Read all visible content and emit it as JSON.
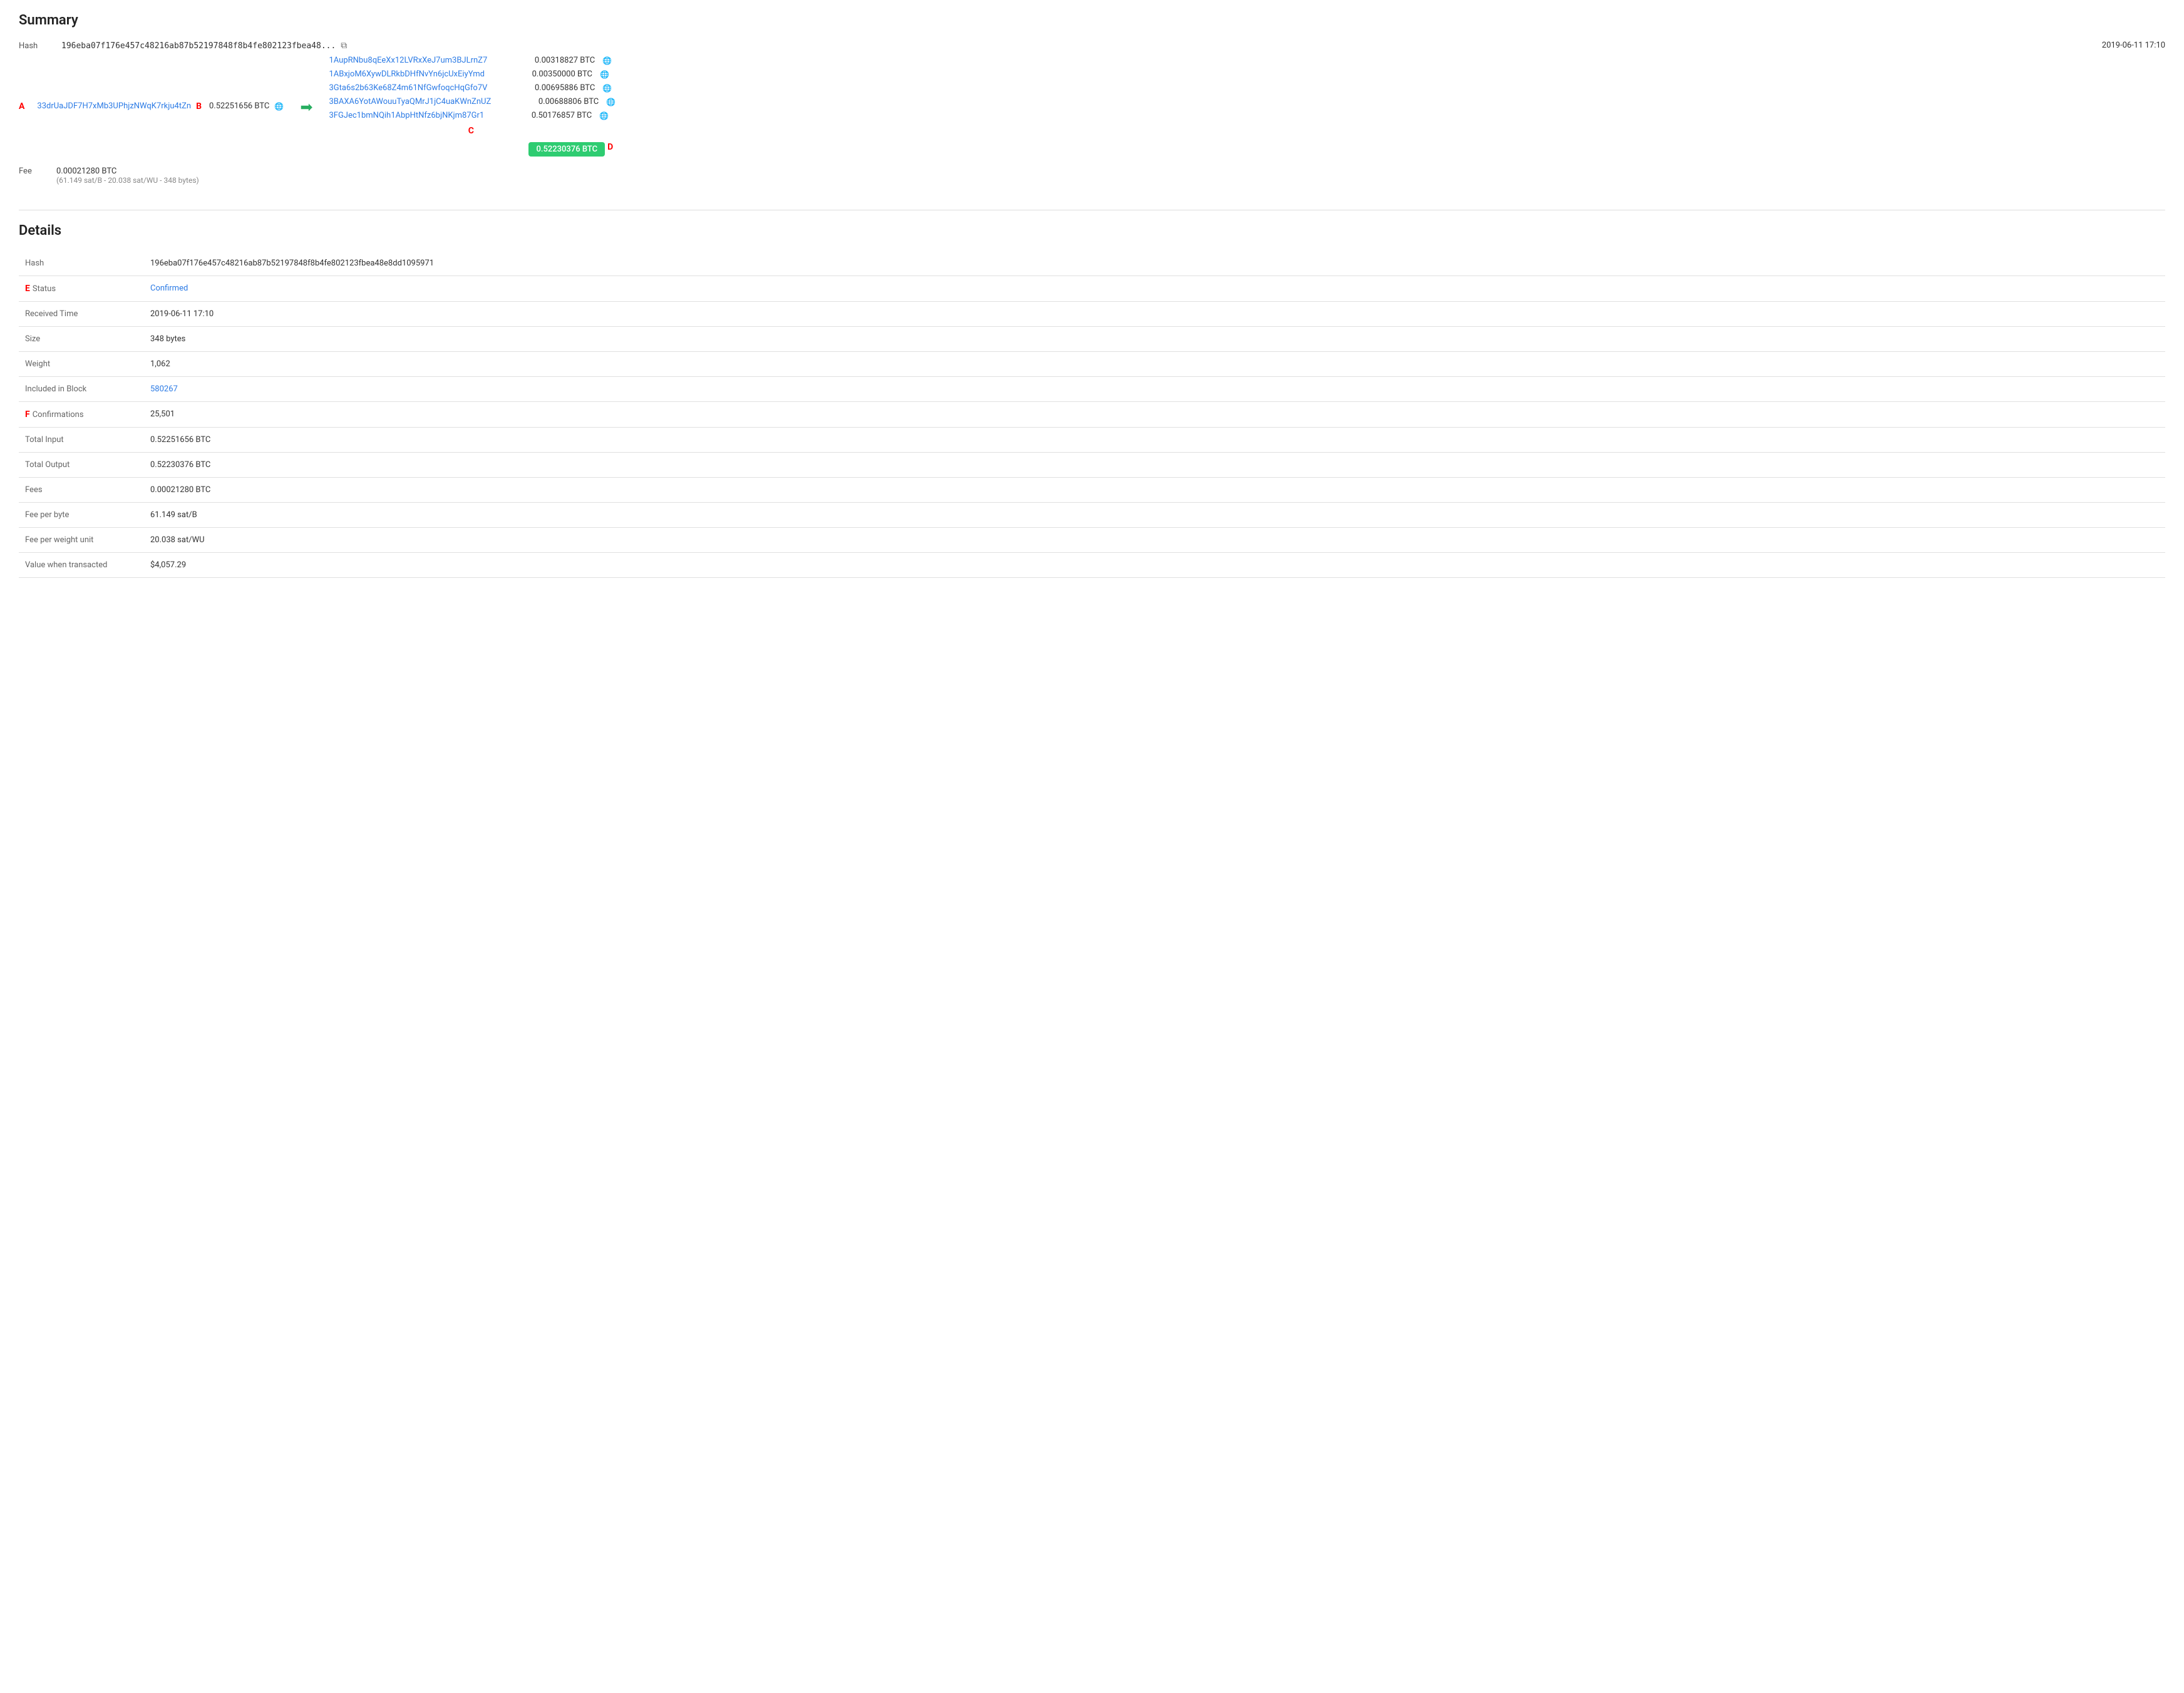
{
  "page": {
    "summary_title": "Summary",
    "details_title": "Details",
    "label_a": "A",
    "label_b": "B",
    "label_c": "C",
    "label_d": "D",
    "label_e": "E",
    "label_f": "F"
  },
  "summary": {
    "hash_label": "Hash",
    "hash_short": "196eba07f176e457c48216ab87b52197848f8b4fe802123fbea48...",
    "timestamp": "2019-06-11 17:10",
    "input_address": "33drUaJDF7H7xMb3UPhjzNWqK7rkju4tZn",
    "input_amount": "0.52251656 BTC",
    "arrow": "➡",
    "outputs": [
      {
        "address": "1AupRNbu8qEeXx12LVRxXeJ7um3BJLrnZ7",
        "amount": "0.00318827 BTC"
      },
      {
        "address": "1ABxjoM6XywDLRkbDHfNvYn6jcUxEiyYmd",
        "amount": "0.00350000 BTC"
      },
      {
        "address": "3Gta6s2b63Ke68Z4m61NfGwfoqcHqGfo7V",
        "amount": "0.00695886 BTC"
      },
      {
        "address": "3BAXA6YotAWouuTyaQMrJ1jC4uaKWnZnUZ",
        "amount": "0.00688806 BTC"
      },
      {
        "address": "3FGJec1bmNQih1AbpHtNfz6bjNKjm87Gr1",
        "amount": "0.50176857 BTC"
      }
    ],
    "total_output_badge": "0.52230376 BTC",
    "fee_label": "Fee",
    "fee_main": "0.00021280 BTC",
    "fee_sub": "(61.149 sat/B - 20.038 sat/WU - 348 bytes)"
  },
  "details": {
    "rows": [
      {
        "label": "Hash",
        "value": "196eba07f176e457c48216ab87b52197848f8b4fe802123fbea48e8dd1095971",
        "type": "text"
      },
      {
        "label": "Status",
        "value": "Confirmed",
        "type": "confirmed"
      },
      {
        "label": "Received Time",
        "value": "2019-06-11 17:10",
        "type": "text"
      },
      {
        "label": "Size",
        "value": "348 bytes",
        "type": "text"
      },
      {
        "label": "Weight",
        "value": "1,062",
        "type": "text"
      },
      {
        "label": "Included in Block",
        "value": "580267",
        "type": "link"
      },
      {
        "label": "Confirmations",
        "value": "25,501",
        "type": "text"
      },
      {
        "label": "Total Input",
        "value": "0.52251656 BTC",
        "type": "text"
      },
      {
        "label": "Total Output",
        "value": "0.52230376 BTC",
        "type": "text"
      },
      {
        "label": "Fees",
        "value": "0.00021280 BTC",
        "type": "text"
      },
      {
        "label": "Fee per byte",
        "value": "61.149 sat/B",
        "type": "text"
      },
      {
        "label": "Fee per weight unit",
        "value": "20.038 sat/WU",
        "type": "text"
      },
      {
        "label": "Value when transacted",
        "value": "$4,057.29",
        "type": "text"
      }
    ]
  }
}
